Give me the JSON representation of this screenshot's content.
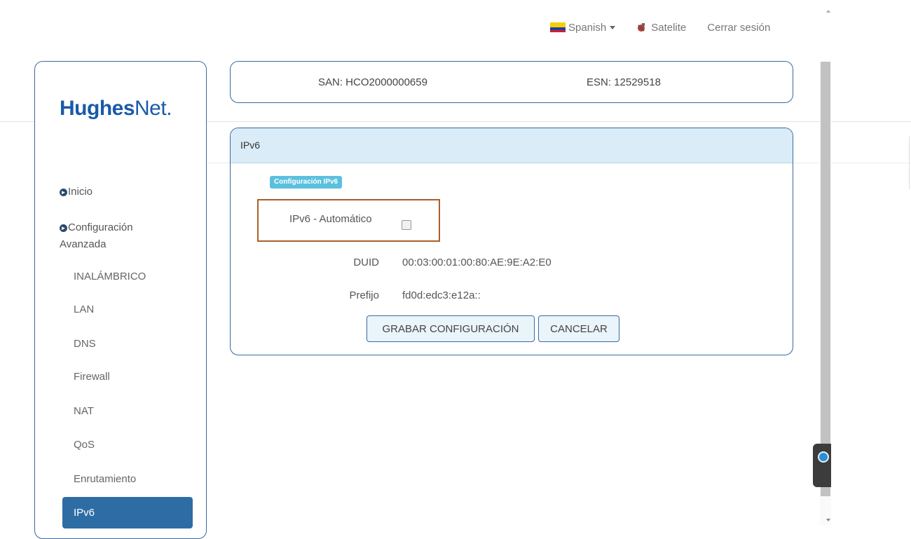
{
  "topbar": {
    "language": "Spanish",
    "satellite": "Satelite",
    "logout": "Cerrar sesión"
  },
  "brand": {
    "name_bold": "Hughes",
    "name_light": "Net",
    "dot": ".",
    "color": "#1a5aa8"
  },
  "sidebar": {
    "inicio": "Inicio",
    "advanced_line1": "Configuración",
    "advanced_line2": "Avanzada",
    "items": [
      "INALÁMBRICO",
      "LAN",
      "DNS",
      "Firewall",
      "NAT",
      "QoS",
      "Enrutamiento"
    ],
    "active": "IPv6"
  },
  "device": {
    "san": "SAN: HCO2000000659",
    "esn": "ESN: 12529518"
  },
  "panel": {
    "title": "IPv6",
    "section_label": "Configuración IPv6",
    "auto_label": "IPv6 - Automático",
    "auto_checked": false,
    "duid_label": "DUID",
    "duid_value": "00:03:00:01:00:80:AE:9E:A2:E0",
    "prefix_label": "Prefijo",
    "prefix_value": "fd0d:edc3:e12a::",
    "save_button": "GRABAR CONFIGURACIÓN",
    "cancel_button": "CANCELAR"
  },
  "colors": {
    "accent": "#2e6da4",
    "border": "#3b6a9c",
    "panel_header": "#d9ecf7",
    "label_badge": "#5bc0de",
    "highlight_box": "#a85f2a"
  }
}
